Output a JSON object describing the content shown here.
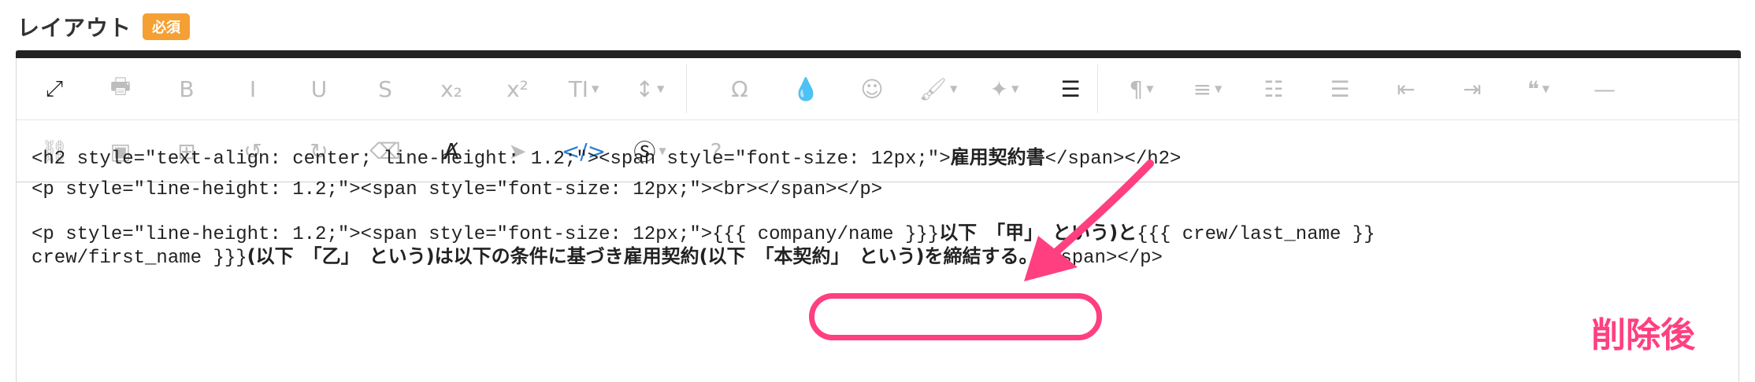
{
  "section": {
    "title": "レイアウト",
    "badge": "必須"
  },
  "toolbar": {
    "row1": [
      {
        "name": "fullscreen-icon",
        "glyph": "⤢",
        "dark": true
      },
      {
        "name": "print-icon",
        "glyph": "🖶"
      },
      {
        "name": "bold-icon",
        "glyph": "B"
      },
      {
        "name": "italic-icon",
        "glyph": "I"
      },
      {
        "name": "underline-icon",
        "glyph": "U"
      },
      {
        "name": "strikethrough-icon",
        "glyph": "S"
      },
      {
        "name": "subscript-icon",
        "glyph": "x₂"
      },
      {
        "name": "superscript-icon",
        "glyph": "x²"
      },
      {
        "name": "font-size-icon",
        "glyph": "TI",
        "caret": true
      },
      {
        "name": "line-height-icon",
        "glyph": "↕",
        "caret": true
      },
      {
        "name": "special-characters-icon",
        "glyph": "Ω"
      },
      {
        "name": "color-icon",
        "glyph": "💧"
      },
      {
        "name": "emoticons-icon",
        "glyph": "☺"
      },
      {
        "name": "paint-format-icon",
        "glyph": "🖌",
        "caret": true
      },
      {
        "name": "magic-wand-icon",
        "glyph": "✦",
        "caret": true
      },
      {
        "name": "page-break-icon",
        "glyph": "☰",
        "dark": true
      },
      {
        "name": "paragraph-icon",
        "glyph": "¶",
        "caret": true
      },
      {
        "name": "align-icon",
        "glyph": "≡",
        "caret": true
      },
      {
        "name": "ordered-list-icon",
        "glyph": "☷"
      },
      {
        "name": "unordered-list-icon",
        "glyph": "☰"
      },
      {
        "name": "outdent-icon",
        "glyph": "⇤"
      },
      {
        "name": "indent-icon",
        "glyph": "⇥"
      },
      {
        "name": "quote-icon",
        "glyph": "❝",
        "caret": true
      },
      {
        "name": "horizontal-line-icon",
        "glyph": "—"
      }
    ],
    "row2": [
      {
        "name": "link-icon",
        "glyph": "⛓"
      },
      {
        "name": "image-icon",
        "glyph": "▣"
      },
      {
        "name": "table-icon",
        "glyph": "⊞"
      },
      {
        "name": "undo-icon",
        "glyph": "↺"
      },
      {
        "name": "redo-icon",
        "glyph": "↻"
      },
      {
        "name": "eraser-icon",
        "glyph": "⌫"
      },
      {
        "name": "clear-formatting-icon",
        "glyph": "A̸",
        "dark": true
      },
      {
        "name": "select-all-icon",
        "glyph": "➤"
      },
      {
        "name": "code-view-icon",
        "glyph": "</>",
        "blue": true
      },
      {
        "name": "variables-icon",
        "glyph": "Ⓢ",
        "dark": true,
        "caret": true
      },
      {
        "name": "help-icon",
        "glyph": "?"
      }
    ]
  },
  "content": {
    "line1_code": "<h2 style=\"text-align: center; line-height: 1.2;\"><span style=\"font-size: 12px;\">",
    "line1_jp": "雇用契約書",
    "line1_end": "</span></h2>",
    "line2": "<p style=\"line-height: 1.2;\"><span style=\"font-size: 12px;\"><br></span></p>",
    "line3_code": "<p style=\"line-height: 1.2;\"><span style=\"font-size: 12px;\">",
    "line3_var1": "{{{ company/name }}}",
    "line3_jp1": "以下　「甲」　という)と",
    "line3_var2": "{{{ crew/last_name }}",
    "line4_var": "crew/first_name }}}",
    "line4_jp": "(以下　「乙」　という)は以下の条件に基づき雇用契約(以下　「本契約」　という)を締結する。",
    "line4_end": "</span></p>"
  },
  "annotation": {
    "label": "削除後",
    "color": "#ff3f80"
  }
}
